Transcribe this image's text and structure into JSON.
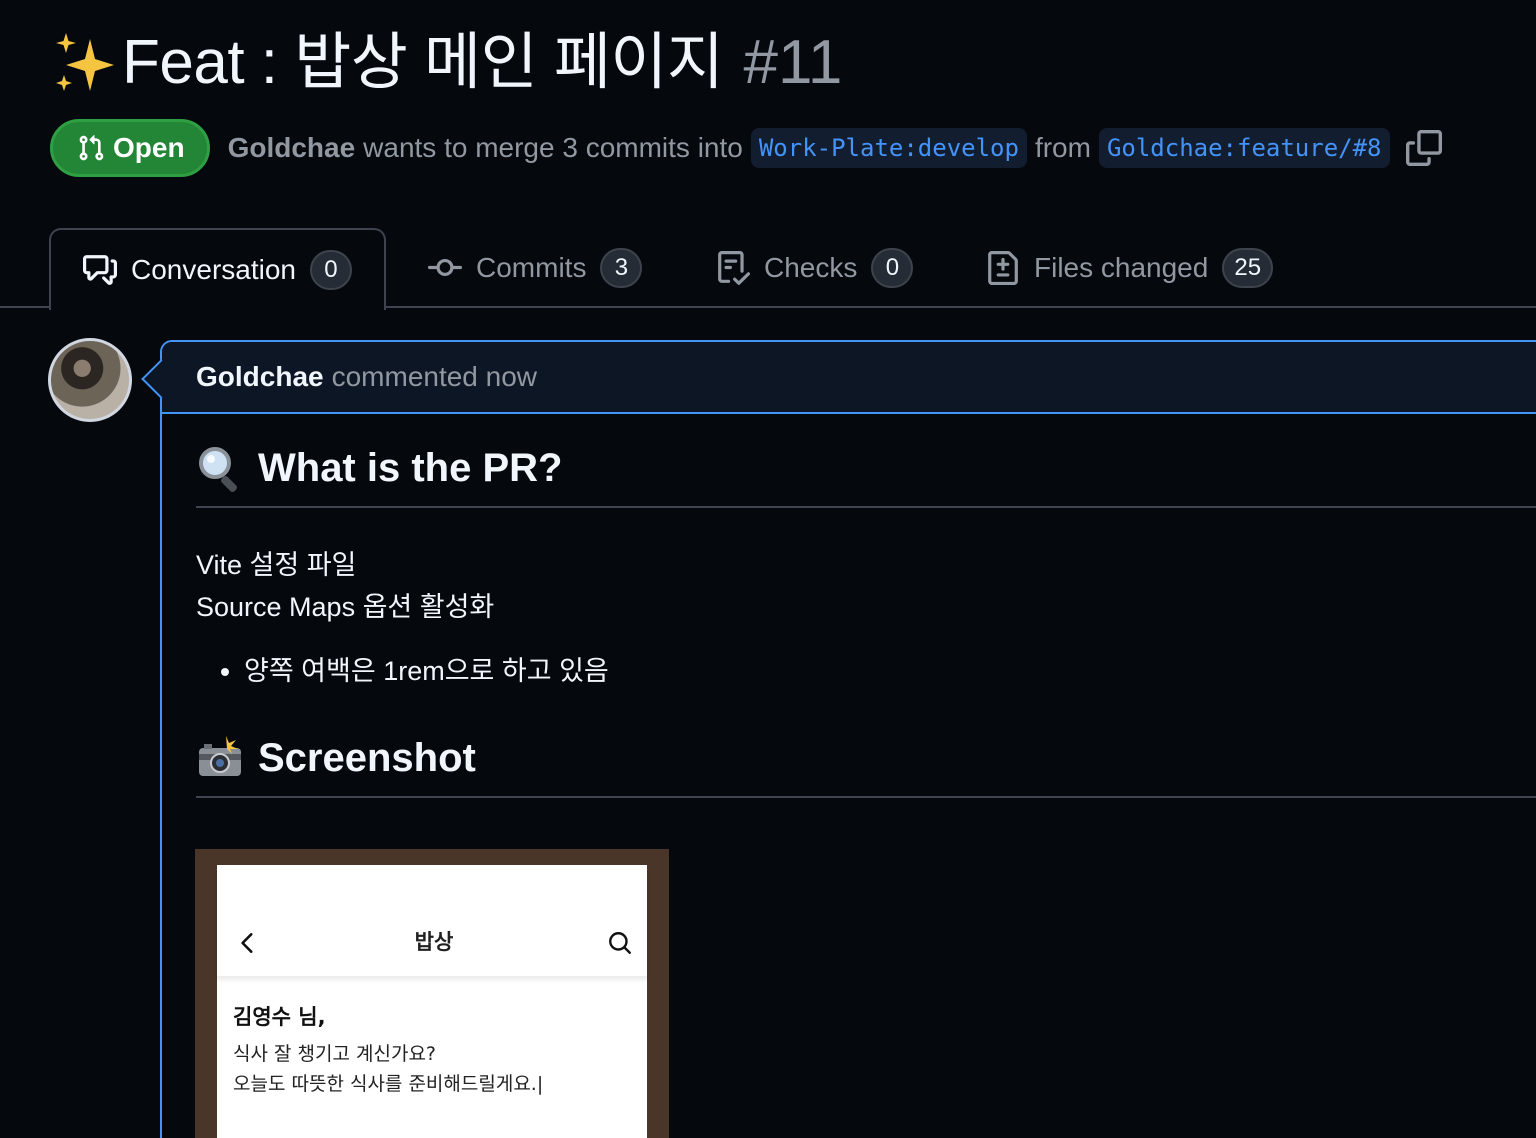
{
  "pr": {
    "title": "Feat : 밥상 메인 페이지",
    "number": "#11",
    "state": "Open",
    "author": "Goldchae",
    "merge_text": "wants to merge 3 commits into",
    "base_branch": "Work-Plate:develop",
    "from_text": "from",
    "head_branch": "Goldchae:feature/#8"
  },
  "tabs": [
    {
      "label": "Conversation",
      "count": "0"
    },
    {
      "label": "Commits",
      "count": "3"
    },
    {
      "label": "Checks",
      "count": "0"
    },
    {
      "label": "Files changed",
      "count": "25"
    }
  ],
  "comment": {
    "author": "Goldchae",
    "meta": "commented now",
    "heading1": "What is the PR?",
    "line1": "Vite 설정 파일",
    "line2": "Source Maps 옵션 활성화",
    "bullet1": "양쪽 여백은 1rem으로 하고 있음",
    "heading2": "Screenshot"
  },
  "screenshot": {
    "title": "밥상",
    "greeting": "김영수 님,",
    "line1": "식사 잘 챙기고 계신가요?",
    "line2": "오늘도 따뜻한 식사를 준비해드릴게요.|"
  },
  "colors": {
    "accent": "#4493f8",
    "open_green": "#238636",
    "background": "#05080d"
  }
}
